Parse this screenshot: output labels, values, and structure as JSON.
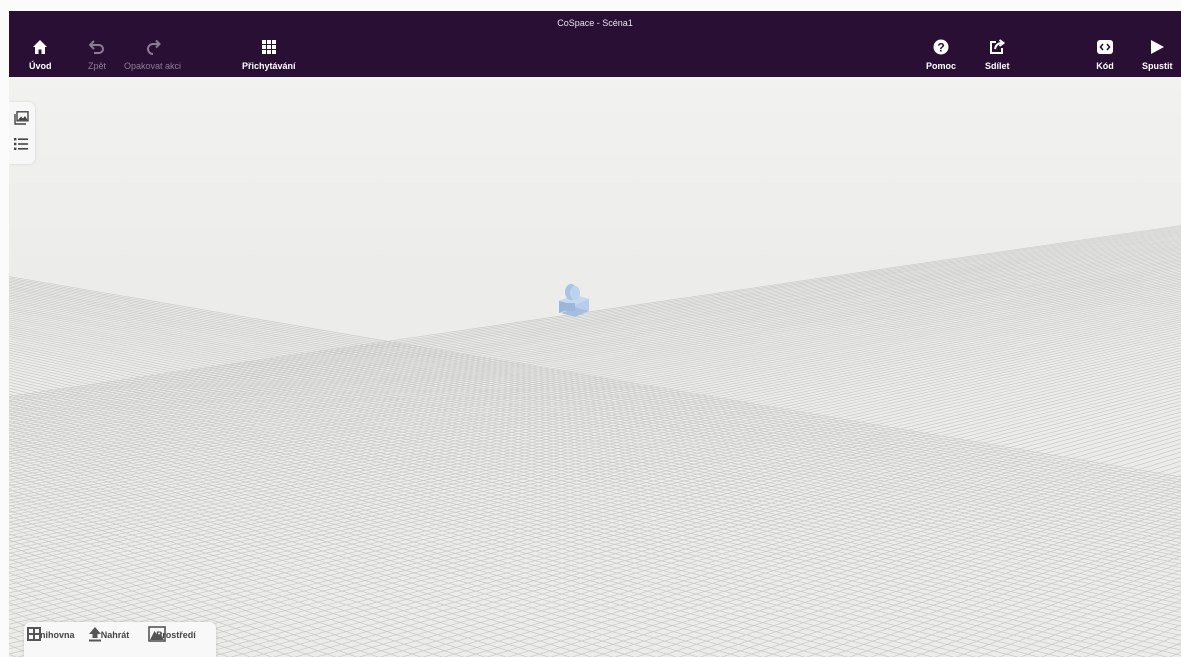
{
  "window": {
    "title": "CoSpace - Scéna1"
  },
  "toolbar": {
    "home": {
      "label": "Úvod",
      "icon": "home-icon"
    },
    "undo": {
      "label": "Zpět",
      "icon": "undo-icon"
    },
    "redo": {
      "label": "Opakovat akci",
      "icon": "redo-icon"
    },
    "snap": {
      "label": "Přichytávání",
      "icon": "grid-icon"
    },
    "help": {
      "label": "Pomoc",
      "icon": "help-icon"
    },
    "share": {
      "label": "Sdílet",
      "icon": "share-icon"
    },
    "code": {
      "label": "Kód",
      "icon": "code-icon"
    },
    "run": {
      "label": "Spustit",
      "icon": "play-icon"
    }
  },
  "left_panel": {
    "items": [
      {
        "icon": "gallery-icon"
      },
      {
        "icon": "list-icon"
      }
    ]
  },
  "bottom_panel": {
    "items": [
      {
        "label": "Knihovna",
        "icon": "library-icon"
      },
      {
        "label": "Nahrát",
        "icon": "upload-icon"
      },
      {
        "label": "Prostředí",
        "icon": "environment-icon"
      }
    ]
  },
  "colors": {
    "topbar": "#2a0f35",
    "ground": "#ececea",
    "grid_line": "#c9c9c7",
    "object": "#a9c3e4"
  }
}
